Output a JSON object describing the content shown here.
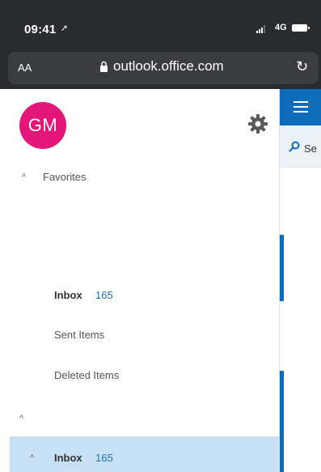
{
  "status_bar": {
    "time": "09:41",
    "network": "4G",
    "icons": [
      "location-arrow-icon",
      "signal-icon",
      "battery-icon"
    ]
  },
  "browser": {
    "text_size_button": "AA",
    "url": "outlook.office.com",
    "icons": [
      "lock-icon",
      "reload-icon"
    ]
  },
  "nav": {
    "avatar_initials": "GM",
    "favorites_label": "Favorites",
    "favorites": [
      {
        "label": "Inbox",
        "count": "165"
      },
      {
        "label": "Sent Items"
      },
      {
        "label": "Deleted Items"
      }
    ],
    "account_folders": [
      {
        "label": "Inbox",
        "count": "165",
        "selected": true
      }
    ]
  },
  "reading_pane": {
    "search_text": "Se"
  },
  "colors": {
    "accent": "#0f6cbd",
    "avatar": "#e5167a",
    "selected_bg": "#c7e0f4",
    "count": "#1a73b5",
    "chrome_bg": "#2a2b2e"
  }
}
